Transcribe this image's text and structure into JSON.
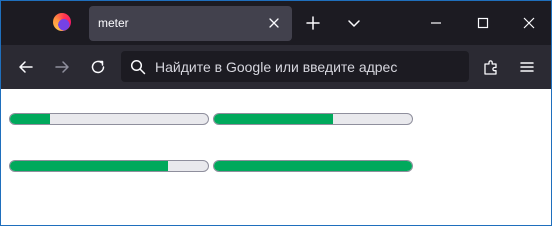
{
  "tab": {
    "title": "meter"
  },
  "urlbar": {
    "placeholder": "Найдите в Google или введите адрес"
  },
  "meters": [
    {
      "value": 0.2
    },
    {
      "value": 0.6
    },
    {
      "value": 0.8
    },
    {
      "value": 1.0
    }
  ],
  "colors": {
    "meter_fill": "#00a95c",
    "meter_track": "#e9e9ed",
    "tabstrip": "#1c1b22",
    "toolbar": "#2b2a33",
    "active_tab": "#42414d"
  }
}
